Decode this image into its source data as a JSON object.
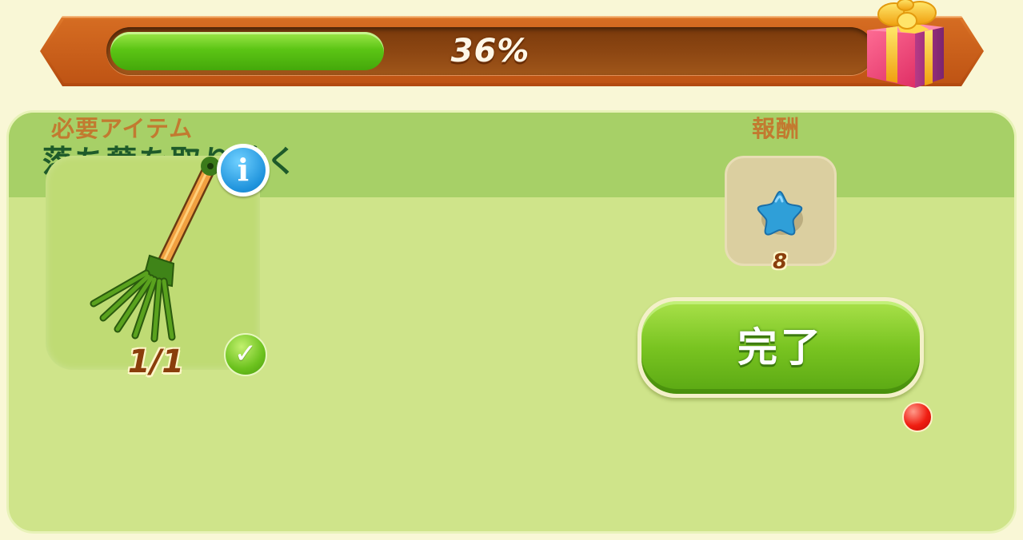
{
  "progress": {
    "percent_label": "36%",
    "value": 0.36
  },
  "task": {
    "title": "落ち葉を取り除く"
  },
  "required": {
    "label": "必要アイテム",
    "item_icon": "rake-icon",
    "count": "1/1",
    "completed": true
  },
  "reward": {
    "label": "報酬",
    "icon": "blue-star-icon",
    "amount": "8"
  },
  "actions": {
    "complete_label": "完了",
    "has_notification": true
  },
  "colors": {
    "progress_fill": "#5cc515",
    "header_bg": "#a7d067",
    "panel_bg": "#cfe48a",
    "title_text": "#1e5a2a",
    "section_label": "#c27a30",
    "star": "#2f9fd8"
  }
}
